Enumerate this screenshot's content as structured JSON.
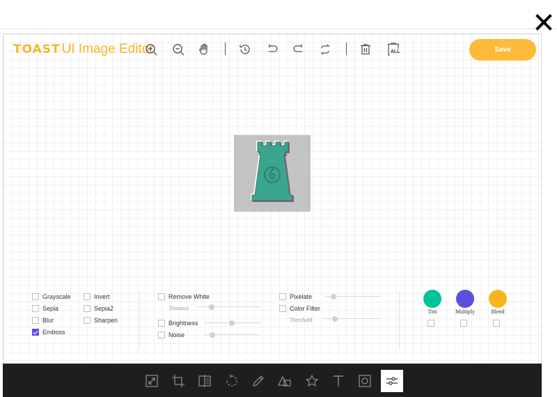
{
  "header": {
    "close_icon": "close-icon"
  },
  "editor": {
    "logo_brand": "TOAST",
    "logo_product": "UI Image Editor",
    "save_label": "Save",
    "accent_color": "#fdba3b",
    "toolbar_icons": [
      "zoom-in-icon",
      "zoom-out-icon",
      "hand-icon",
      "history-icon",
      "undo-icon",
      "redo-icon",
      "reset-icon",
      "delete-icon",
      "delete-all-icon"
    ],
    "delete_all_text": "ALL"
  },
  "filters": {
    "col1": [
      {
        "label": "Grayscale",
        "checked": false
      },
      {
        "label": "Sepia",
        "checked": false
      },
      {
        "label": "Blur",
        "checked": false
      },
      {
        "label": "Emboss",
        "checked": true
      }
    ],
    "col2": [
      {
        "label": "Invert",
        "checked": false
      },
      {
        "label": "Sepia2",
        "checked": false
      },
      {
        "label": "Sharpen",
        "checked": false
      }
    ],
    "remove_white": {
      "label": "Remove White",
      "checked": false,
      "sub_label": "Distance"
    },
    "brightness": {
      "label": "Brightness",
      "checked": false
    },
    "noise": {
      "label": "Noise",
      "checked": false
    },
    "pixelate": {
      "label": "Pixelate",
      "checked": false
    },
    "color_filter": {
      "label": "Color Filter",
      "checked": false,
      "sub_label": "Threshold"
    },
    "swatches": [
      {
        "label": "Tint",
        "color": "#00c29b"
      },
      {
        "label": "Multiply",
        "color": "#5b4fe0"
      },
      {
        "label": "Blend",
        "color": "#fbb51c"
      }
    ]
  },
  "bottom_menu": {
    "icons": [
      "resize-icon",
      "crop-icon",
      "flip-icon",
      "rotate-icon",
      "draw-icon",
      "shape-icon",
      "star-icon",
      "text-icon",
      "mask-icon",
      "filter-icon"
    ],
    "active": "filter-icon"
  }
}
